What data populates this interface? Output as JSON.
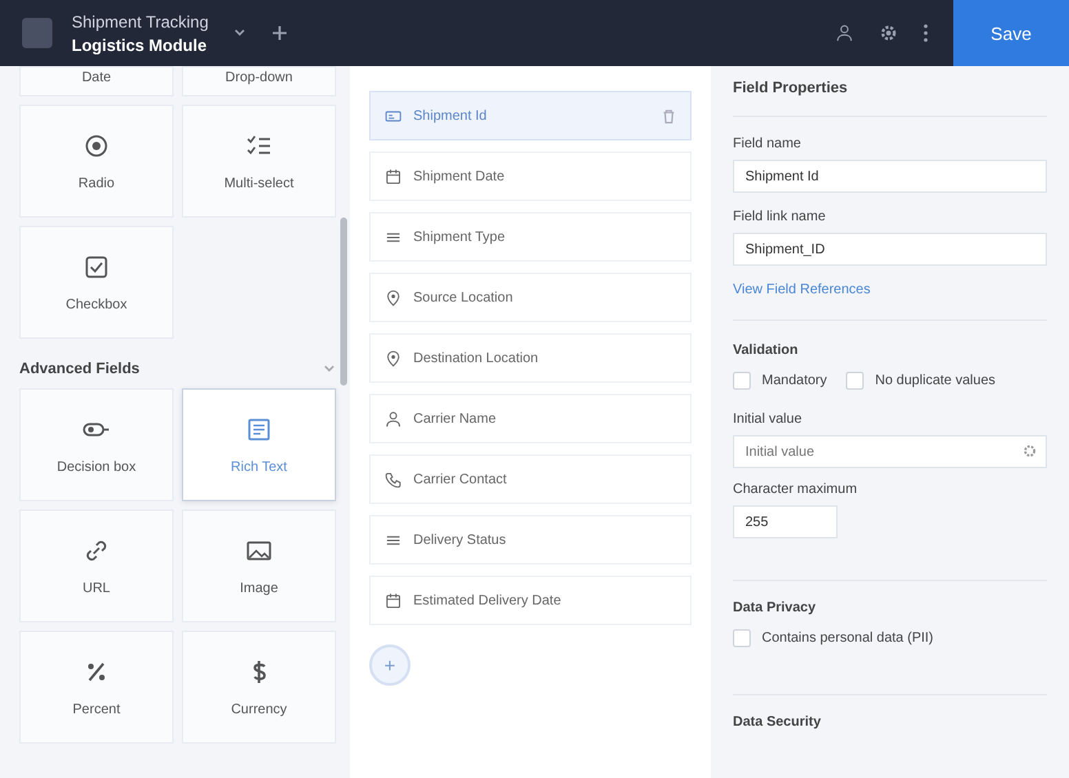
{
  "header": {
    "title": "Shipment Tracking",
    "subtitle": "Logistics Module",
    "save": "Save"
  },
  "palette": {
    "top_cut": [
      "Date",
      "Drop-down"
    ],
    "basic": [
      {
        "label": "Radio",
        "kind": "radio",
        "selected": false
      },
      {
        "label": "Multi-select",
        "kind": "multi",
        "selected": false
      },
      {
        "label": "Checkbox",
        "kind": "checkbox",
        "selected": false
      }
    ],
    "section": {
      "title": "Advanced Fields",
      "expanded": true
    },
    "advanced": [
      {
        "label": "Decision box",
        "kind": "toggle",
        "selected": false
      },
      {
        "label": "Rich Text",
        "kind": "richtext",
        "selected": true
      },
      {
        "label": "URL",
        "kind": "link",
        "selected": false
      },
      {
        "label": "Image",
        "kind": "image",
        "selected": false
      },
      {
        "label": "Percent",
        "kind": "percent",
        "selected": false
      },
      {
        "label": "Currency",
        "kind": "currency",
        "selected": false
      }
    ]
  },
  "form_fields": [
    {
      "label": "Shipment Id",
      "kind": "id",
      "selected": true
    },
    {
      "label": "Shipment Date",
      "kind": "calendar",
      "selected": false
    },
    {
      "label": "Shipment Type",
      "kind": "list",
      "selected": false
    },
    {
      "label": "Source Location",
      "kind": "pin",
      "selected": false
    },
    {
      "label": "Destination Location",
      "kind": "pin",
      "selected": false
    },
    {
      "label": "Carrier Name",
      "kind": "person",
      "selected": false
    },
    {
      "label": "Carrier Contact",
      "kind": "phone",
      "selected": false
    },
    {
      "label": "Delivery Status",
      "kind": "list",
      "selected": false
    },
    {
      "label": "Estimated Delivery Date",
      "kind": "calendar",
      "selected": false
    }
  ],
  "add_button": "+",
  "properties": {
    "title": "Field Properties",
    "field_name": {
      "label": "Field name",
      "value": "Shipment Id"
    },
    "link_name": {
      "label": "Field link name",
      "value": "Shipment_ID"
    },
    "references_link": "View Field References",
    "validation": {
      "title": "Validation",
      "options": [
        {
          "label": "Mandatory",
          "checked": false
        },
        {
          "label": "No duplicate values",
          "checked": false
        }
      ]
    },
    "initial_value": {
      "label": "Initial value",
      "placeholder": "Initial value"
    },
    "max_chars": {
      "label": "Character maximum",
      "value": "255"
    },
    "privacy": {
      "title": "Data Privacy",
      "options": [
        {
          "label": "Contains personal data (PII)",
          "checked": false
        }
      ]
    },
    "security": {
      "title": "Data Security"
    }
  }
}
